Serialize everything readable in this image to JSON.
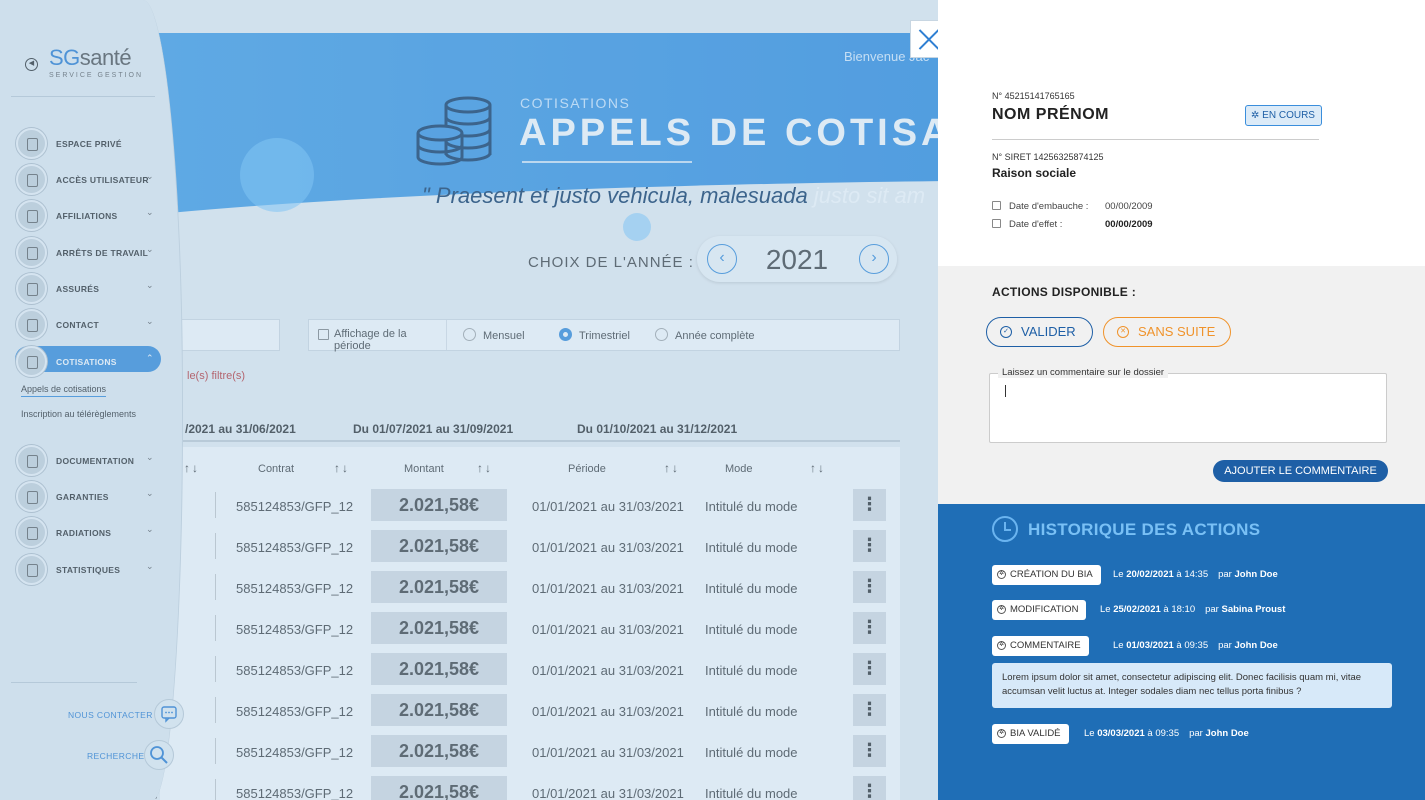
{
  "header": {
    "welcome": "Bienvenue Jac",
    "subtitle": "COTISATIONS",
    "title": "APPELS DE COTISA",
    "quote_dark": "\" Praesent et justo vehicula, malesuada ",
    "quote_light": "justo sit am"
  },
  "year_selector": {
    "label": "CHOIX DE L'ANNÉE :",
    "value": "2021",
    "prev": "‹",
    "next": "›"
  },
  "period_filter": {
    "label": "Affichage de la période",
    "options": [
      "Mensuel",
      "Trimestriel",
      "Année complète"
    ],
    "selected": "Trimestriel"
  },
  "filters_text": "le(s) filtre(s)",
  "period_tabs": [
    "/2021 au 31/06/2021",
    "Du 01/07/2021 au 31/09/2021",
    "Du 01/10/2021 au 31/12/2021"
  ],
  "table": {
    "columns": [
      "Contrat",
      "Montant",
      "Période",
      "Mode"
    ],
    "sort_icon": "↑↓",
    "rows": [
      {
        "contrat": "585124853/GFP_12",
        "montant": "2.021,58€",
        "periode": "01/01/2021 au 31/03/2021",
        "mode": "Intitulé du mode"
      },
      {
        "contrat": "585124853/GFP_12",
        "montant": "2.021,58€",
        "periode": "01/01/2021 au 31/03/2021",
        "mode": "Intitulé du mode"
      },
      {
        "contrat": "585124853/GFP_12",
        "montant": "2.021,58€",
        "periode": "01/01/2021 au 31/03/2021",
        "mode": "Intitulé du mode"
      },
      {
        "contrat": "585124853/GFP_12",
        "montant": "2.021,58€",
        "periode": "01/01/2021 au 31/03/2021",
        "mode": "Intitulé du mode"
      },
      {
        "contrat": "585124853/GFP_12",
        "montant": "2.021,58€",
        "periode": "01/01/2021 au 31/03/2021",
        "mode": "Intitulé du mode"
      },
      {
        "contrat": "585124853/GFP_12",
        "montant": "2.021,58€",
        "periode": "01/01/2021 au 31/03/2021",
        "mode": "Intitulé du mode"
      },
      {
        "contrat": "585124853/GFP_12",
        "montant": "2.021,58€",
        "periode": "01/01/2021 au 31/03/2021",
        "mode": "Intitulé du mode"
      },
      {
        "contrat": "585124853/GFP_12",
        "montant": "2.021,58€",
        "periode": "01/01/2021 au 31/03/2021",
        "mode": "Intitulé du mode"
      }
    ],
    "row_menu_icon": "⋮",
    "last_row_prefix": "s"
  },
  "sidebar": {
    "logo_main": "SG",
    "logo_lite": "santé",
    "logo_sub": "SERVICE GESTION",
    "items": [
      {
        "label": "ESPACE PRIVÉ",
        "icon": "home-icon"
      },
      {
        "label": "ACCÈS UTILISATEUR",
        "icon": "user-add-icon"
      },
      {
        "label": "AFFILIATIONS",
        "icon": "document-icon"
      },
      {
        "label": "ARRÊTS DE TRAVAIL",
        "icon": "document-icon"
      },
      {
        "label": "ASSURÉS",
        "icon": "users-icon"
      },
      {
        "label": "CONTACT",
        "icon": "contact-card-icon"
      },
      {
        "label": "COTISATIONS",
        "icon": "coins-icon"
      },
      {
        "label": "DOCUMENTATION",
        "icon": "document-icon"
      },
      {
        "label": "GARANTIES",
        "icon": "clipboard-icon"
      },
      {
        "label": "RADIATIONS",
        "icon": "user-remove-icon"
      },
      {
        "label": "STATISTIQUES",
        "icon": "chart-icon"
      }
    ],
    "subitems": [
      "Appels de cotisations",
      "Inscription au télérèglements"
    ],
    "contact_link": "NOUS CONTACTER",
    "search_link": "RECHERCHE",
    "chevron": "⌄",
    "chevron_up": "⌃"
  },
  "panel": {
    "number": "N° 45215141765165",
    "name": "NOM PRÉNOM",
    "status": "EN COURS",
    "siret": "N° SIRET 14256325874125",
    "raison_sociale": "Raison sociale",
    "date_embauche_label": "Date d'embauche :",
    "date_embauche": "00/00/2009",
    "date_effet_label": "Date d'effet :",
    "date_effet": "00/00/2009",
    "actions_title": "ACTIONS DISPONIBLE :",
    "validate": "VALIDER",
    "dismiss": "SANS SUITE",
    "comment_label": "Laissez un commentaire sur le dossier",
    "comment_value": "",
    "add_comment": "AJOUTER LE COMMENTAIRE",
    "history_title": "HISTORIQUE DES ACTIONS",
    "history": [
      {
        "tag": "CRÉATION DU BIA",
        "le": "Le ",
        "date": "20/02/2021",
        "time": " à 14:35",
        "par": "par ",
        "user": "John Doe"
      },
      {
        "tag": "MODIFICATION",
        "le": "Le ",
        "date": "25/02/2021",
        "time": " à 18:10",
        "par": "par ",
        "user": "Sabina Proust"
      },
      {
        "tag": "COMMENTAIRE",
        "le": "Le ",
        "date": "01/03/2021",
        "time": " à 09:35",
        "par": "par ",
        "user": "John Doe"
      },
      {
        "tag": "BIA VALIDÉ",
        "le": "Le ",
        "date": "03/03/2021",
        "time": " à 09:35",
        "par": "par ",
        "user": "John Doe"
      }
    ],
    "comment_text": "Lorem ipsum dolor sit amet, consectetur adipiscing elit. Donec facilisis quam mi, vitae accumsan velit luctus at. Integer sodales diam nec tellus porta finibus ?"
  },
  "colors": {
    "primary": "#3a8edc",
    "dark_blue": "#1e5fa6",
    "orange": "#f0932b",
    "history_bg": "#1f6eb6",
    "error": "#c23a3a"
  }
}
